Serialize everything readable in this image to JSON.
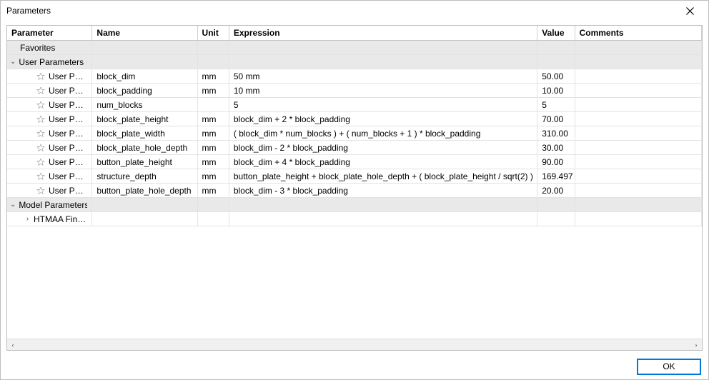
{
  "window": {
    "title": "Parameters"
  },
  "columns": {
    "parameter": "Parameter",
    "name": "Name",
    "unit": "Unit",
    "expression": "Expression",
    "value": "Value",
    "comments": "Comments"
  },
  "groups": {
    "favorites": "Favorites",
    "user_parameters": "User Parameters",
    "model_parameters": "Model Parameters"
  },
  "model_child": "HTMAA Final ...",
  "row_label": "User Par...",
  "rows": [
    {
      "name": "block_dim",
      "unit": "mm",
      "expression": "50 mm",
      "value": "50.00"
    },
    {
      "name": "block_padding",
      "unit": "mm",
      "expression": "10 mm",
      "value": "10.00"
    },
    {
      "name": "num_blocks",
      "unit": "",
      "expression": "5",
      "value": "5"
    },
    {
      "name": "block_plate_height",
      "unit": "mm",
      "expression": "block_dim + 2 * block_padding",
      "value": "70.00"
    },
    {
      "name": "block_plate_width",
      "unit": "mm",
      "expression": "( block_dim * num_blocks ) + ( num_blocks + 1 ) * block_padding",
      "value": "310.00"
    },
    {
      "name": "block_plate_hole_depth",
      "unit": "mm",
      "expression": "block_dim - 2 * block_padding",
      "value": "30.00"
    },
    {
      "name": "button_plate_height",
      "unit": "mm",
      "expression": "block_dim + 4 * block_padding",
      "value": "90.00"
    },
    {
      "name": "structure_depth",
      "unit": "mm",
      "expression": "button_plate_height + block_plate_hole_depth + ( block_plate_height / sqrt(2) )",
      "value": "169.497"
    },
    {
      "name": "button_plate_hole_depth",
      "unit": "mm",
      "expression": "block_dim - 3 * block_padding",
      "value": "20.00"
    }
  ],
  "buttons": {
    "ok": "OK"
  }
}
